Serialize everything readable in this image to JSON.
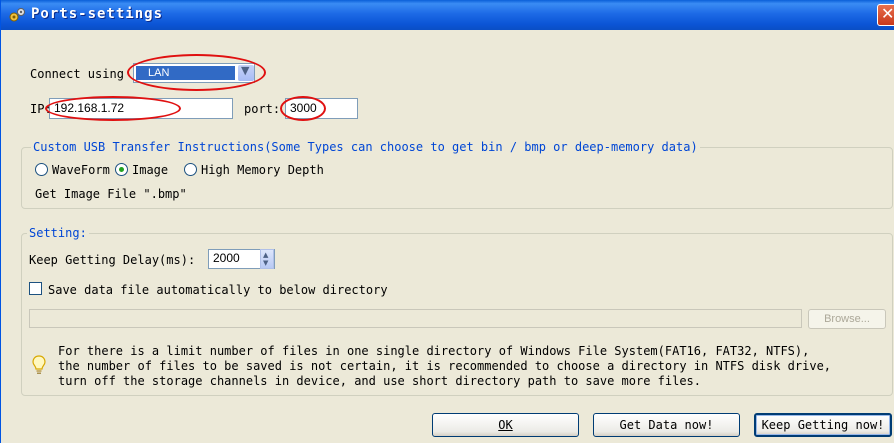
{
  "window": {
    "title": "Ports-settings"
  },
  "connection": {
    "connect_label": "Connect using",
    "connect_value": "LAN",
    "ip_label": "IP:",
    "ip_value": "192.168.1.72",
    "port_label": "port:",
    "port_value": "3000"
  },
  "usb_group": {
    "title": "Custom USB Transfer Instructions(Some Types can choose to get bin / bmp or deep-memory data)",
    "options": [
      {
        "label": "WaveForm",
        "selected": false
      },
      {
        "label": "Image",
        "selected": true
      },
      {
        "label": "High Memory Depth",
        "selected": false
      }
    ],
    "file_note": "Get Image File \".bmp\""
  },
  "setting_group": {
    "title": "Setting:",
    "delay_label": "Keep Getting Delay(ms):",
    "delay_value": "2000",
    "save_label": "Save data file automatically to below directory",
    "save_checked": false,
    "directory_value": "",
    "browse_label": "Browse...",
    "info_lines": [
      "For there is a limit number of files in one single directory of Windows File System(FAT16, FAT32, NTFS),",
      "the number of  files to be saved is not certain,  it is recommended to choose a directory in NTFS disk drive,",
      "turn off the storage channels in device, and use short directory path to save more files."
    ]
  },
  "buttons": {
    "ok": "OK",
    "get_data": "Get Data now!",
    "keep_getting": "Keep Getting now!"
  },
  "colors": {
    "annotation": "#e01010",
    "group_title": "#0046d5",
    "title_bar": "#0b55d6"
  },
  "icons": [
    "ports-settings-icon",
    "close-icon",
    "dropdown-arrow-icon",
    "spinner-up-icon",
    "spinner-down-icon",
    "lightbulb-icon"
  ]
}
